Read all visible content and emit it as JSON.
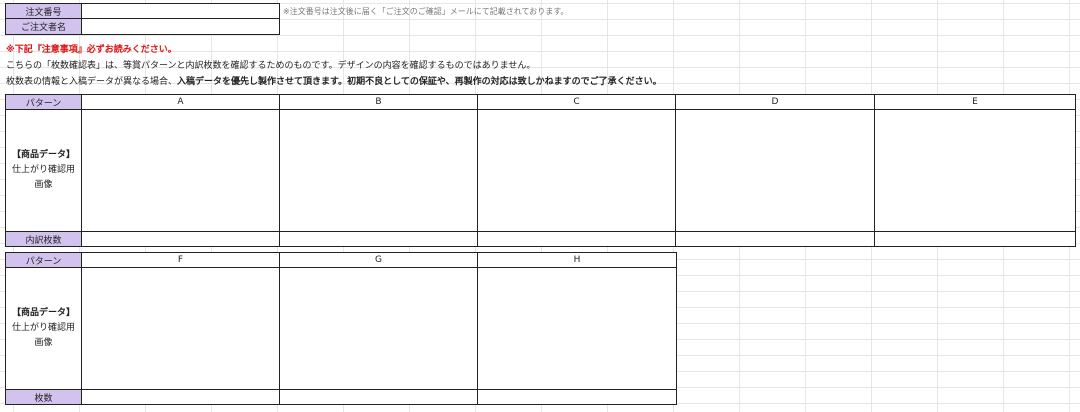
{
  "order_info": {
    "order_number_label": "注文番号",
    "order_number_value": "",
    "customer_name_label": "ご注文者名",
    "customer_name_value": "",
    "order_note": "※注文番号は注文後に届く「ご注文のご確認」メールにて記載されております。"
  },
  "notice": {
    "warning": "※下記『注意事項』必ずお読みください。",
    "line1": "こちらの「枚数確認表」は、等賞パターンと内訳枚数を確認するためのものです。デザインの内容を確認するものではありません。",
    "line2_prefix": "枚数表の情報と入稿データが異なる場合、",
    "line2_bold": "入稿データを優先し製作させて頂きます。初期不良としての保証や、再製作の対応は致しかねますのでご了承ください。"
  },
  "table1": {
    "pattern_label": "パターン",
    "columns": [
      "A",
      "B",
      "C",
      "D",
      "E"
    ],
    "product_label_1": "【商品データ】",
    "product_label_2": "仕上がり確認用",
    "product_label_3": "画像",
    "count_label": "内訳枚数"
  },
  "table2": {
    "pattern_label": "パターン",
    "columns": [
      "F",
      "G",
      "H"
    ],
    "product_label_1": "【商品データ】",
    "product_label_2": "仕上がり確認用",
    "product_label_3": "画像",
    "count_label": "枚数"
  },
  "colors": {
    "label_background": "#d2c3ee",
    "warning_text": "#e01010",
    "grid_line": "#e6e6e6"
  }
}
